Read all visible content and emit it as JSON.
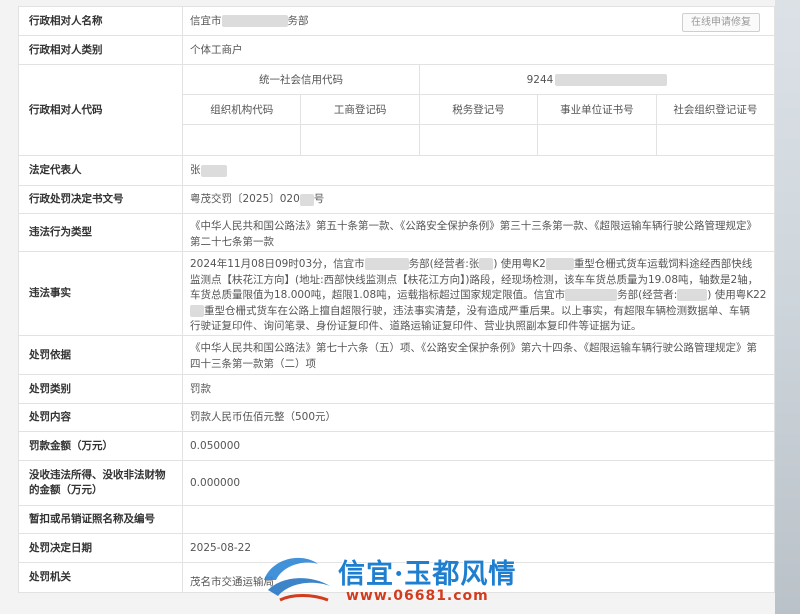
{
  "rows": {
    "name": {
      "label": "行政相对人名称",
      "prefix": "信宜市",
      "suffix": "务部",
      "button": "在线申请修复"
    },
    "category": {
      "label": "行政相对人类别",
      "value": "个体工商户"
    },
    "code": {
      "label": "行政相对人代码",
      "credit_code_label": "统一社会信用代码",
      "credit_code_prefix": "9244",
      "headers": [
        "组织机构代码",
        "工商登记码",
        "税务登记号",
        "事业单位证书号",
        "社会组织登记证号"
      ]
    },
    "legal_rep": {
      "label": "法定代表人",
      "value": "张"
    },
    "doc_no": {
      "label": "行政处罚决定书文号",
      "prefix": "粤茂交罚〔2025〕020",
      "suffix": "号"
    },
    "violation_type": {
      "label": "违法行为类型",
      "value": "《中华人民共和国公路法》第五十条第一款、《公路安全保护条例》第三十三条第一款、《超限运输车辆行驶公路管理规定》第二十七条第一款"
    },
    "facts": {
      "label": "违法事实",
      "line1a": "2024年11月08日09时03分，信宜市",
      "line1b": "务部(经营者:张",
      "line1c": ") 使用粤K2",
      "line1d": "重型仓栅式货车运载饲料途经西部快线",
      "line2": "监测点【枎花江方向】(地址:西部快线监测点【枎花江方向】)路段，经现场检测，该车车货总质量为19.08吨，轴数是2轴，",
      "line3": "车货总质量限值为18.000吨，超限1.08吨，运载指标超过国家规定限值。信宜市",
      "line3b": "务部(经营者:",
      "line3c": ") 使用粤K22",
      "line4": "重型仓栅式货车在公路上擅自超限行驶，违法事实清楚，没有造成严重后果。以上事实，有超限车辆检测数据单、车辆",
      "line5": "行驶证复印件、询问笔录、身份证复印件、道路运输证复印件、营业执照副本复印件等证据为证。"
    },
    "basis": {
      "label": "处罚依据",
      "value": "《中华人民共和国公路法》第七十六条（五）项、《公路安全保护条例》第六十四条、《超限运输车辆行驶公路管理规定》第四十三条第一款第（二）项"
    },
    "penalty_type": {
      "label": "处罚类别",
      "value": "罚款"
    },
    "penalty_content": {
      "label": "处罚内容",
      "value": "罚款人民币伍佰元整（500元）"
    },
    "fine": {
      "label": "罚款金额（万元）",
      "value": "0.050000"
    },
    "confiscation": {
      "label": "没收违法所得、没收非法财物的金额（万元）",
      "value": "0.000000"
    },
    "license": {
      "label": "暂扣或吊销证照名称及编号",
      "value": ""
    },
    "decision_date": {
      "label": "处罚决定日期",
      "value": "2025-08-22"
    },
    "authority": {
      "label": "处罚机关",
      "value": "茂名市交通运输局"
    }
  },
  "watermark": {
    "title": "信宜·玉都风情",
    "url": "www.06681.com"
  }
}
